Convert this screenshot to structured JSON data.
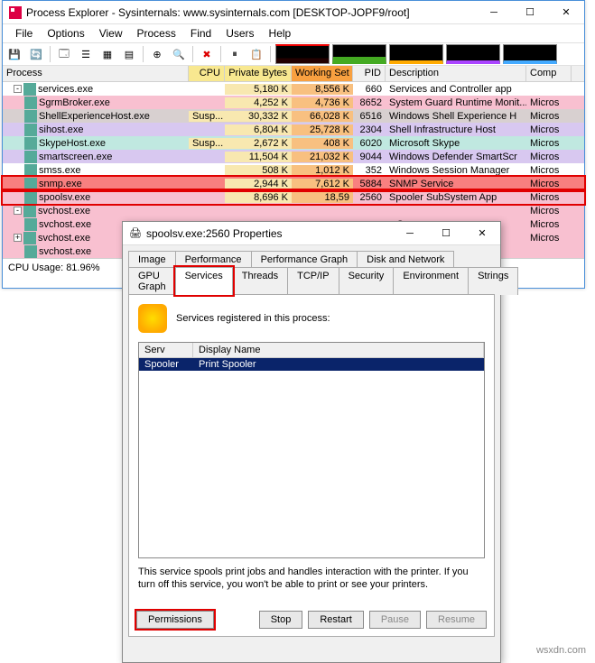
{
  "main": {
    "title": "Process Explorer - Sysinternals: www.sysinternals.com [DESKTOP-JOPF9/root]",
    "menus": [
      "File",
      "Options",
      "View",
      "Process",
      "Find",
      "Users",
      "Help"
    ],
    "columns": {
      "proc": "Process",
      "cpu": "CPU",
      "pb": "Private Bytes",
      "ws": "Working Set",
      "pid": "PID",
      "desc": "Description",
      "comp": "Comp"
    },
    "rows": [
      {
        "indent": 1,
        "exp": "-",
        "name": "services.exe",
        "cpu": "",
        "pb": "5,180 K",
        "ws": "8,556 K",
        "pid": "660",
        "desc": "Services and Controller app",
        "comp": "",
        "bg": ""
      },
      {
        "indent": 2,
        "name": "SgrmBroker.exe",
        "cpu": "",
        "pb": "4,252 K",
        "ws": "4,736 K",
        "pid": "8652",
        "desc": "System Guard Runtime Monit...",
        "comp": "Micros",
        "bg": "bg-pink"
      },
      {
        "indent": 2,
        "name": "ShellExperienceHost.exe",
        "cpu": "Susp...",
        "pb": "30,332 K",
        "ws": "66,028 K",
        "pid": "6516",
        "desc": "Windows Shell Experience H",
        "comp": "Micros",
        "bg": "bg-gray"
      },
      {
        "indent": 2,
        "name": "sihost.exe",
        "cpu": "",
        "pb": "6,804 K",
        "ws": "25,728 K",
        "pid": "2304",
        "desc": "Shell Infrastructure Host",
        "comp": "Micros",
        "bg": "bg-purple"
      },
      {
        "indent": 2,
        "name": "SkypeHost.exe",
        "cpu": "Susp...",
        "pb": "2,672 K",
        "ws": "408 K",
        "pid": "6020",
        "desc": "Microsoft Skype",
        "comp": "Micros",
        "bg": "bg-teal"
      },
      {
        "indent": 2,
        "name": "smartscreen.exe",
        "cpu": "",
        "pb": "11,504 K",
        "ws": "21,032 K",
        "pid": "9044",
        "desc": "Windows Defender SmartScr",
        "comp": "Micros",
        "bg": "bg-purple"
      },
      {
        "indent": 2,
        "name": "smss.exe",
        "cpu": "",
        "pb": "508 K",
        "ws": "1,012 K",
        "pid": "352",
        "desc": "Windows Session Manager",
        "comp": "Micros",
        "bg": ""
      },
      {
        "indent": 2,
        "name": "snmp.exe",
        "cpu": "",
        "pb": "2,944 K",
        "ws": "7,612 K",
        "pid": "5884",
        "desc": "SNMP Service",
        "comp": "Micros",
        "bg": "bg-red",
        "hl": true
      },
      {
        "indent": 2,
        "name": "spoolsv.exe",
        "cpu": "",
        "pb": "8,696 K",
        "ws": "18,59",
        "pid": "2560",
        "desc": "Spooler SubSystem App",
        "comp": "Micros",
        "bg": "bg-pink",
        "hl": true
      },
      {
        "indent": 1,
        "exp": "-",
        "name": "svchost.exe",
        "cpu": "",
        "pb": "",
        "ws": "",
        "pid": "",
        "desc": "",
        "comp": "Micros",
        "bg": "bg-pink"
      },
      {
        "indent": 2,
        "name": "svchost.exe",
        "cpu": "",
        "pb": "",
        "ws": "",
        "pid": "",
        "desc": "s S...",
        "comp": "Micros",
        "bg": "bg-pink"
      },
      {
        "indent": 1,
        "exp": "+",
        "name": "svchost.exe",
        "cpu": "",
        "pb": "",
        "ws": "",
        "pid": "",
        "desc": "",
        "comp": "Micros",
        "bg": "bg-pink"
      },
      {
        "indent": 2,
        "name": "svchost.exe",
        "cpu": "",
        "pb": "",
        "ws": "",
        "pid": "",
        "desc": "",
        "comp": "",
        "bg": "bg-pink"
      }
    ],
    "status": "CPU Usage: 81.96%"
  },
  "dlg": {
    "title": "spoolsv.exe:2560 Properties",
    "tabs1": [
      "Image",
      "Performance",
      "Performance Graph",
      "Disk and Network"
    ],
    "tabs2": [
      "GPU Graph",
      "Services",
      "Threads",
      "TCP/IP",
      "Security",
      "Environment",
      "Strings"
    ],
    "activeTab": "Services",
    "label": "Services registered in this process:",
    "svc_cols": {
      "serv": "Serv",
      "disp": "Display Name"
    },
    "svc_row": {
      "serv": "Spooler",
      "disp": "Print Spooler"
    },
    "desc": "This service spools print jobs and handles interaction with the printer.  If you turn off this service, you won't be able to print or see your printers.",
    "buttons": {
      "perm": "Permissions",
      "stop": "Stop",
      "restart": "Restart",
      "pause": "Pause",
      "resume": "Resume"
    }
  },
  "watermark": "wsxdn.com"
}
